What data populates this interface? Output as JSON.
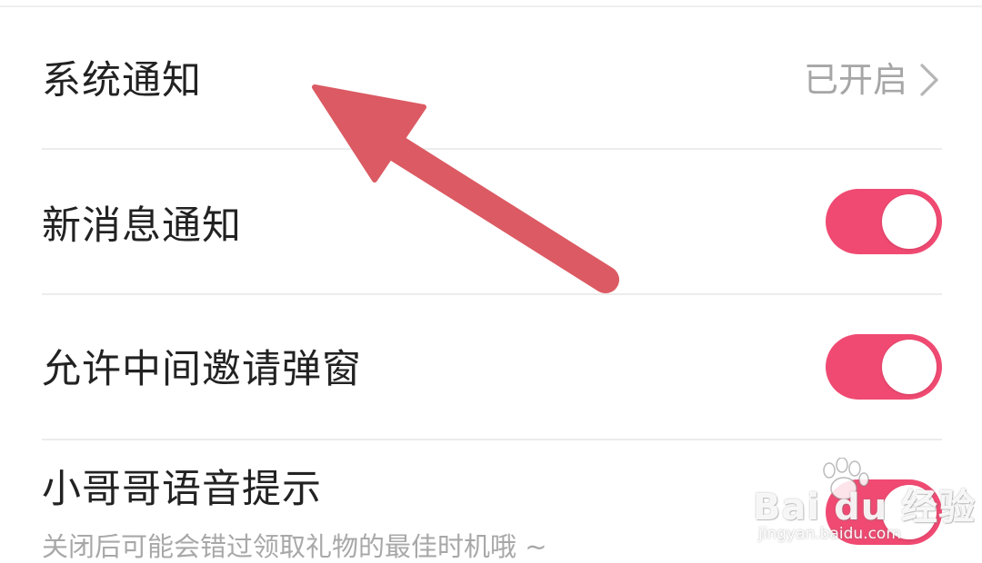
{
  "settings": {
    "rows": [
      {
        "title": "系统通知",
        "status_text": "已开启",
        "control": "chevron-right"
      },
      {
        "title": "新消息通知",
        "control": "toggle",
        "toggle_on": true
      },
      {
        "title": "允许中间邀请弹窗",
        "control": "toggle",
        "toggle_on": true
      },
      {
        "title": "小哥哥语音提示",
        "subtitle": "关闭后可能会错过领取礼物的最佳时机哦 ~",
        "control": "toggle",
        "toggle_on": true
      }
    ]
  },
  "watermark": {
    "brand_text": "Bai du 经验",
    "url_text": "jingyan.baidu.com"
  },
  "annotation": {
    "icon": "red-arrow-icon",
    "color": "#dc5a63"
  },
  "colors": {
    "toggle_on": "#f04a72",
    "title_text": "#222222",
    "secondary_text": "#a6a6a6",
    "divider": "#ececec",
    "background": "#ffffff"
  }
}
